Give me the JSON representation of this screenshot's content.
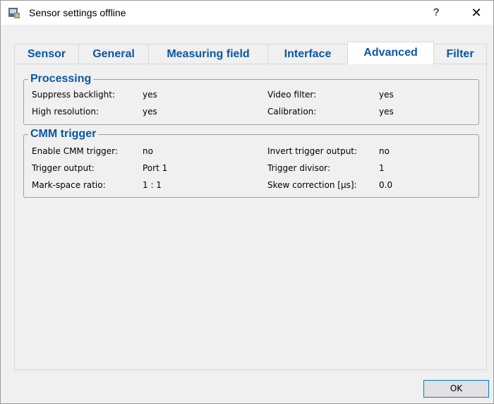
{
  "window": {
    "title": "Sensor settings offline",
    "help_label": "?",
    "close_label": "✕"
  },
  "tabs": [
    {
      "label": "Sensor"
    },
    {
      "label": "General"
    },
    {
      "label": "Measuring field"
    },
    {
      "label": "Interface"
    },
    {
      "label": "Advanced"
    },
    {
      "label": "Filter"
    }
  ],
  "active_tab": "Advanced",
  "processing": {
    "title": "Processing",
    "rows": [
      {
        "label": "Suppress backlight:",
        "value": "yes"
      },
      {
        "label": "High resolution:",
        "value": "yes"
      },
      {
        "label": "Video filter:",
        "value": "yes"
      },
      {
        "label": "Calibration:",
        "value": "yes"
      }
    ]
  },
  "cmm_trigger": {
    "title": "CMM trigger",
    "rows": [
      {
        "label": "Enable CMM trigger:",
        "value": "no"
      },
      {
        "label": "Trigger output:",
        "value": "Port 1"
      },
      {
        "label": "Mark-space ratio:",
        "value": "1 : 1"
      },
      {
        "label": "Invert trigger output:",
        "value": "no"
      },
      {
        "label": "Trigger divisor:",
        "value": "1"
      },
      {
        "label": "Skew correction [µs]:",
        "value": "0.0"
      }
    ]
  },
  "footer": {
    "ok_label": "OK"
  },
  "colors": {
    "accent": "#0a57a4",
    "ok_border": "#0078d7"
  },
  "icons": {
    "app": "sensor-app-icon",
    "help": "help-icon",
    "close": "close-icon"
  }
}
